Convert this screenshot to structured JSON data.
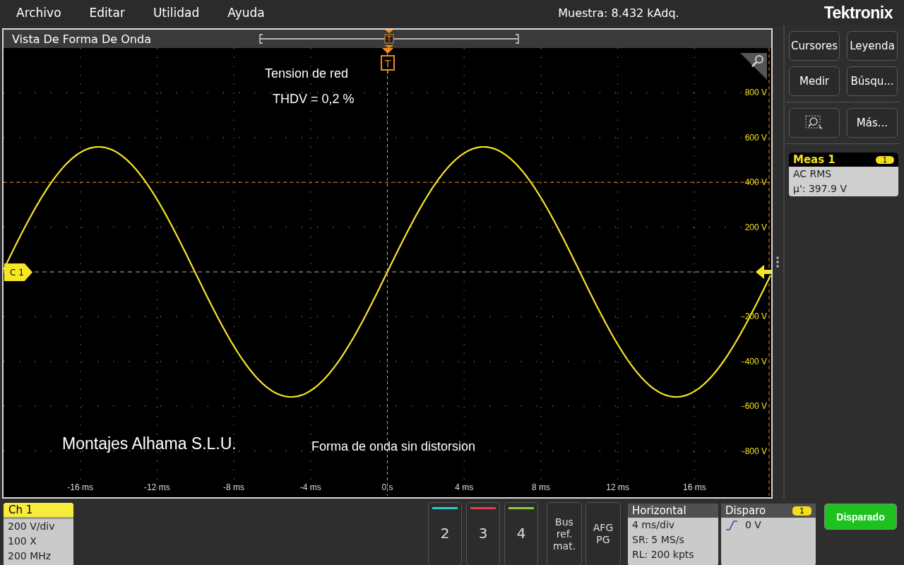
{
  "menu": [
    "Archivo",
    "Editar",
    "Utilidad",
    "Ayuda"
  ],
  "acquisition_status": "Muestra: 8.432 kAdq.",
  "brand": "Tektronix",
  "waveform_view": {
    "title": "Vista De Forma De Onda",
    "record_trigger_label": "T",
    "trigger_label": "T",
    "channel_marker": "C 1",
    "annotations": [
      {
        "text": "Tension de red"
      },
      {
        "text": "THDV = 0,2 %"
      },
      {
        "text": "Montajes Alhama S.L.U."
      },
      {
        "text": "Forma de onda sin distorsion"
      }
    ],
    "y_labels": [
      "800 V",
      "600 V",
      "400 V",
      "200 V",
      "-200 V",
      "-400 V",
      "-600 V",
      "-800 V"
    ],
    "x_labels": [
      "-16 ms",
      "-12 ms",
      "-8 ms",
      "-4 ms",
      "0 s",
      "4 ms",
      "8 ms",
      "12 ms",
      "16 ms"
    ]
  },
  "side_buttons": [
    {
      "kind": "text",
      "label": "Cursores"
    },
    {
      "kind": "text",
      "label": "Leyenda"
    },
    {
      "kind": "text",
      "label": "Medir"
    },
    {
      "kind": "text",
      "label": "Búsqu..."
    },
    {
      "kind": "zoom"
    },
    {
      "kind": "text",
      "label": "Más..."
    }
  ],
  "measurement": {
    "title": "Meas 1",
    "badge": "1",
    "name": "AC RMS",
    "value": "μ': 397.9 V"
  },
  "channel": {
    "title": "Ch 1",
    "lines": [
      "200 V/div",
      "100 X",
      "200 MHz"
    ]
  },
  "channel_buttons": [
    {
      "label": "2",
      "color": "#2bc8d6"
    },
    {
      "label": "3",
      "color": "#e2404e"
    },
    {
      "label": "4",
      "color": "#8ccc3a"
    }
  ],
  "extra_buttons": [
    "Bus ref. mat.",
    "AFG PG"
  ],
  "horizontal": {
    "title": "Horizontal",
    "lines": [
      "4 ms/div",
      "SR: 5 MS/s",
      "RL: 200 kpts"
    ]
  },
  "trigger": {
    "title": "Disparo",
    "badge": "1",
    "level": "0 V"
  },
  "trigger_status": "Disparado"
}
